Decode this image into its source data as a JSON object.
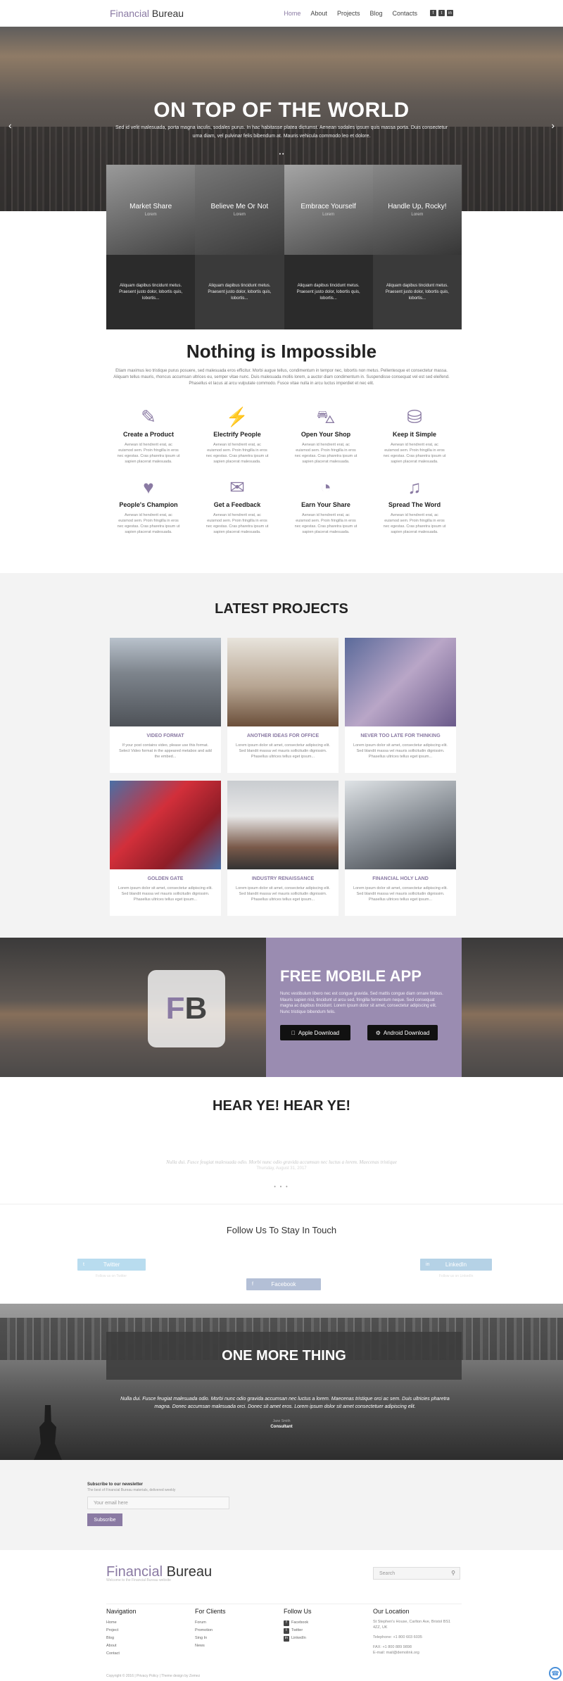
{
  "header": {
    "logo_a": "Financial",
    "logo_b": "Bureau",
    "nav": [
      "Home",
      "About",
      "Projects",
      "Blog",
      "Contacts"
    ],
    "social_icons": [
      "facebook-icon",
      "twitter-icon",
      "linkedin-icon"
    ]
  },
  "hero": {
    "title": "ON TOP OF THE WORLD",
    "text": "Sed id velit malesuada, porta magna iaculis, sodales purus. In hac habitasse platea dictumst. Aenean sodales ipsum quis massa porta. Duis consectetur urna diam, vel pulvinar felis bibendum at. Mauris vehicula commodo leo et dolore.",
    "prev": "‹",
    "next": "›",
    "dots": "• •"
  },
  "tiles": [
    {
      "title": "Market Share",
      "sub": "Lorem",
      "text": "Aliquam dapibus tincidunt metus. Praesent justo dolor, lobortis quis, lobortis..."
    },
    {
      "title": "Believe Me Or Not",
      "sub": "Lorem",
      "text": "Aliquam dapibus tincidunt metus. Praesent justo dolor, lobortis quis, lobortis..."
    },
    {
      "title": "Embrace Yourself",
      "sub": "Lorem",
      "text": "Aliquam dapibus tincidunt metus. Praesent justo dolor, lobortis quis, lobortis..."
    },
    {
      "title": "Handle Up, Rocky!",
      "sub": "Lorem",
      "text": "Aliquam dapibus tincidunt metus. Praesent justo dolor, lobortis quis, lobortis..."
    }
  ],
  "features": {
    "title": "Nothing is Impossible",
    "lead": "Etiam maximus leo tristique purus posuere, sed malesuada eros efficitur. Morbi augue tellus, condimentum in tempor nec, lobortis non metus. Pellentesque et consectetur massa. Aliquam tellus mauris, rhoncus accumsan ultrices eu, semper vitae nunc. Duis malesuada mollis lorem, a auctor diam condimentum in. Suspendisse consequat vel est sed eleifend. Phasellus et lacus at arcu vulputate commodo. Fusce vitae nulla in arcu luctus imperdiet et nec elit.",
    "items": [
      {
        "icon": "pencil-icon",
        "glyph": "✎",
        "title": "Create a Product",
        "text": "Aenean id hendrerit erat, ac euismod sem. Proin fringilla in eros nec egestas. Cras pharetra ipsum ut sapien placerat malesuada."
      },
      {
        "icon": "plug-icon",
        "glyph": "⚡",
        "title": "Electrify People",
        "text": "Aenean id hendrerit erat, ac euismod sem. Proin fringilla in eros nec egestas. Cras pharetra ipsum ut sapien placerat malesuada."
      },
      {
        "icon": "basket-icon",
        "glyph": "⛍",
        "title": "Open Your Shop",
        "text": "Aenean id hendrerit erat, ac euismod sem. Proin fringilla in eros nec egestas. Cras pharetra ipsum ut sapien placerat malesuada."
      },
      {
        "icon": "database-icon",
        "glyph": "⛁",
        "title": "Keep it Simple",
        "text": "Aenean id hendrerit erat, ac euismod sem. Proin fringilla in eros nec egestas. Cras pharetra ipsum ut sapien placerat malesuada."
      },
      {
        "icon": "heart-icon",
        "glyph": "♥",
        "title": "People's Champion",
        "text": "Aenean id hendrerit erat, ac euismod sem. Proin fringilla in eros nec egestas. Cras pharetra ipsum ut sapien placerat malesuada."
      },
      {
        "icon": "chat-icon",
        "glyph": "✉",
        "title": "Get a Feedback",
        "text": "Aenean id hendrerit erat, ac euismod sem. Proin fringilla in eros nec egestas. Cras pharetra ipsum ut sapien placerat malesuada."
      },
      {
        "icon": "pie-chart-icon",
        "glyph": "◔",
        "title": "Earn Your Share",
        "text": "Aenean id hendrerit erat, ac euismod sem. Proin fringilla in eros nec egestas. Cras pharetra ipsum ut sapien placerat malesuada."
      },
      {
        "icon": "microphone-icon",
        "glyph": "♫",
        "title": "Spread The Word",
        "text": "Aenean id hendrerit erat, ac euismod sem. Proin fringilla in eros nec egestas. Cras pharetra ipsum ut sapien placerat malesuada."
      }
    ]
  },
  "projects": {
    "title": "LATEST PROJECTS",
    "items": [
      {
        "title": "VIDEO FORMAT",
        "text": "If your post contains video, please use this format. Select Video format in the appeared metabox and add the embed..."
      },
      {
        "title": "ANOTHER IDEAS FOR OFFICE",
        "text": "Lorem ipsum dolor sit amet, consectetur adipiscing elit. Sed blandit massa vel mauris sollicitudin dignissim. Phasellus ultrices tellus eget ipsum..."
      },
      {
        "title": "NEVER TOO LATE FOR THINKING",
        "text": "Lorem ipsum dolor sit amet, consectetur adipiscing elit. Sed blandit massa vel mauris sollicitudin dignissim. Phasellus ultrices tellus eget ipsum..."
      },
      {
        "title": "GOLDEN GATE",
        "text": "Lorem ipsum dolor sit amet, consectetur adipiscing elit. Sed blandit massa vel mauris sollicitudin dignissim. Phasellus ultrices tellus eget ipsum..."
      },
      {
        "title": "INDUSTRY RENAISSANCE",
        "text": "Lorem ipsum dolor sit amet, consectetur adipiscing elit. Sed blandit massa vel mauris sollicitudin dignissim. Phasellus ultrices tellus eget ipsum..."
      },
      {
        "title": "FINANCIAL HOLY LAND",
        "text": "Lorem ipsum dolor sit amet, consectetur adipiscing elit. Sed blandit massa vel mauris sollicitudin dignissim. Phasellus ultrices tellus eget ipsum..."
      }
    ]
  },
  "app": {
    "logo_f": "F",
    "logo_b": "B",
    "title": "FREE MOBILE APP",
    "text": "Nunc vestibulum libero nec est congue gravida. Sed mattis congue diam ornare finibus. Mauris sapien nisi, tincidunt ut arcu sed, fringilla fermentum neque. Sed consequat magna ac dapibus tincidunt. Lorem ipsum dolor sit amet, consectetur adipiscing elit. Nunc tristique bibendum felis.",
    "apple": "Apple Download",
    "android": "Android Download"
  },
  "testimonials": {
    "title": "HEAR YE! HEAR YE!",
    "quote": "Nulla dui. Fusce feugiat malesuada odio. Morbi nunc odio gravida accumsan nec luctus a lorem. Maecenas tristique",
    "date": "Thursday, August 31, 2017",
    "dots": "• • •"
  },
  "follow": {
    "title": "Follow Us To Stay In Touch",
    "twitter": "Twitter",
    "facebook": "Facebook",
    "linkedin": "LinkedIn",
    "twitter_sub": "Follow us on Twitter",
    "linkedin_sub": "Follow us on LinkedIn"
  },
  "omt": {
    "title": "ONE MORE THING",
    "quote": "Nulla dui. Fusce feugiat malesuada odio. Morbi nunc odio gravida accumsan nec luctus a lorem. Maecenas tristique orci ac sem. Duis ultricies pharetra magna. Donec accumsan malesuada orci. Donec sit amet eros. Lorem ipsum dolor sit amet consectetuer adipiscing elit.",
    "name": "Jane Smith",
    "role": "Consultant"
  },
  "newsletter": {
    "title": "Subscribe to our newsletter",
    "sub": "The best of Financial Bureau materials, delivered weekly",
    "placeholder": "Your email here",
    "button": "Subscribe"
  },
  "footer": {
    "logo_a": "Financial",
    "logo_b": "Bureau",
    "tagline": "Welcome to the Financial Bureau website",
    "search_placeholder": "Search",
    "nav_title": "Navigation",
    "nav_items": [
      "Home",
      "Project",
      "Blog",
      "About",
      "Contact"
    ],
    "clients_title": "For Clients",
    "clients_items": [
      "Forum",
      "Promotion",
      "Sing In",
      "News"
    ],
    "follow_title": "Follow Us",
    "follow_items": [
      "Facebook",
      "Twitter",
      "LinkedIn"
    ],
    "location_title": "Our Location",
    "address": "St Stephen's House, Carlton Ave, Bristol BS1 4ZZ, UK",
    "telephone": "Telephone: +1 800 603 6035",
    "fax": "FAX: +1 800 889 9898",
    "email": "E-mail: mail@demolink.org",
    "copyright": "Copyright © 2016 | Privacy Policy | Theme design by Zemez"
  }
}
